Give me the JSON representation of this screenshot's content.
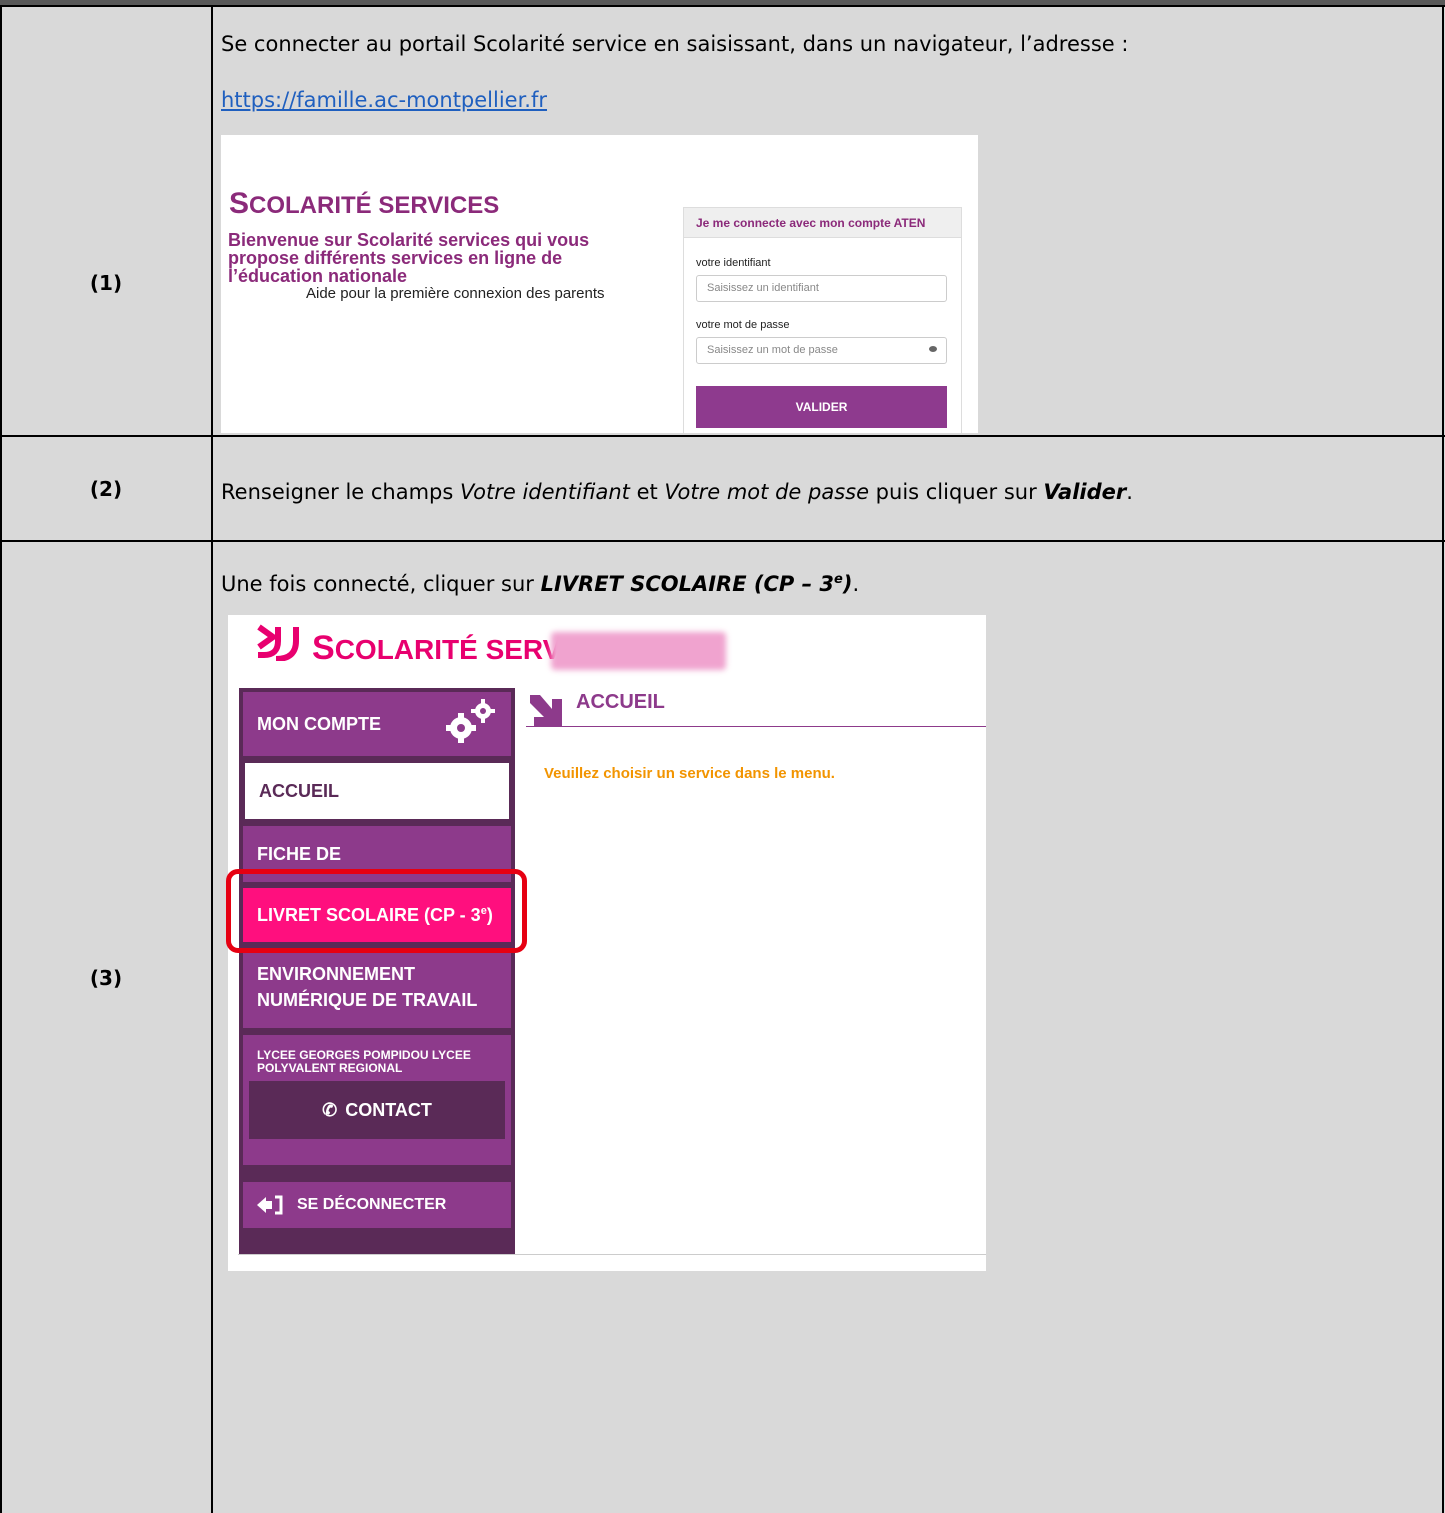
{
  "steps": {
    "s1": "(1)",
    "s2": "(2)",
    "s3": "(3)"
  },
  "step1": {
    "text": "Se connecter au portail Scolarité service en saisissant, dans un navigateur, l’adresse :",
    "url": "https://famille.ac-montpellier.fr"
  },
  "login_screen": {
    "title_initial": "S",
    "title_rest": "COLARITÉ SERVICES",
    "welcome": "Bienvenue sur Scolarité services qui vous propose différents services en ligne de l’éducation nationale",
    "help_link": "Aide pour la première connexion des parents",
    "login_header": "Je me connecte avec mon compte ATEN",
    "id_label": "votre identifiant",
    "id_placeholder": "Saisissez un identifiant",
    "pw_label": "votre mot de passe",
    "pw_placeholder": "Saisissez un mot de passe",
    "submit": "VALIDER"
  },
  "step2": {
    "part1": "Renseigner le champs ",
    "field1": "Votre identifiant",
    "part2": " et ",
    "field2": "Votre mot de passe",
    "part3": " puis cliquer sur ",
    "action": "Valider",
    "end": "."
  },
  "step3": {
    "part1": "Une fois connecté, cliquer sur ",
    "action": "LIVRET SCOLAIRE (CP – 3",
    "action_sup": "e",
    "action_end": ")",
    "end": "."
  },
  "portal": {
    "brand_initial": "S",
    "brand_rest": "COLARITÉ SERVICES",
    "menu": {
      "mon_compte": "MON COMPTE",
      "accueil": "ACCUEIL",
      "fiche": "FICHE DE RENSEIGNEMENTS",
      "livret": "LIVRET SCOLAIRE (CP - 3",
      "livret_sup": "e",
      "livret_end": ")",
      "env_line1": "ENVIRONNEMENT",
      "env_line2": "NUMÉRIQUE DE TRAVAIL",
      "lycee": "LYCEE GEORGES POMPIDOU LYCEE POLYVALENT REGIONAL",
      "contact": "CONTACT",
      "logout": "SE DÉCONNECTER"
    },
    "page_title": "ACCUEIL",
    "message": "Veuillez choisir un service dans le menu."
  },
  "colors": {
    "brand_purple": "#8d3a8b",
    "brand_pink": "#e8006f",
    "highlight_red": "#e60012"
  }
}
